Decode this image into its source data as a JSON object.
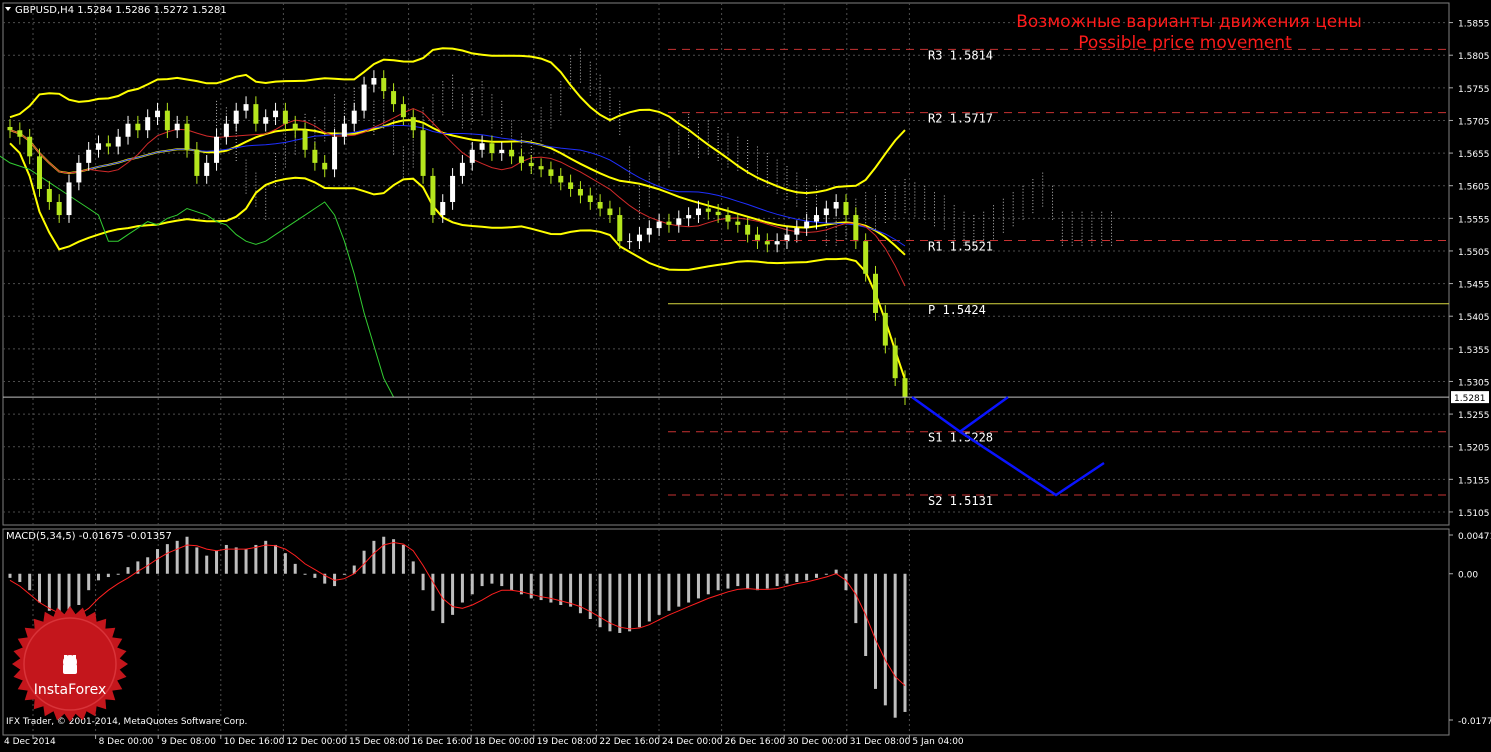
{
  "header": {
    "symbol_info": "GBPUSD,H4  1.5284 1.5286 1.5272 1.5281",
    "macd_info": "MACD(5,34,5) -0.01675 -0.01357",
    "copyright": "IFX Trader, © 2001-2014, MetaQuotes Software Corp.",
    "watermark_ru": "Возможные варианты движения цены",
    "watermark_en": "Possible price movement",
    "logo_text": "InstaForex"
  },
  "colors": {
    "background": "#000000",
    "grid": "#4d4d4d",
    "bull_candle": "#ffffff",
    "bear_candle": "#b5e61d",
    "bollinger": "#ffff00",
    "envelope": "#ffff00",
    "ma_blue": "#1f2fff",
    "ma_red": "#d22a2a",
    "chikou": "#32cd32",
    "kumo": "#b9b9b9",
    "levels_dashed": "#c83232",
    "pivot": "#d8d840",
    "forecast": "#0a14ff",
    "macd_hist": "#bfbfbf",
    "macd_signal": "#ff2020",
    "watermark_text": "#ff1a1a",
    "axis_text": "#ffffff",
    "logo": "#c4161c"
  },
  "chart_data": [
    {
      "type": "candlestick",
      "title": "GBPUSD,H4",
      "ylim": [
        1.5085,
        1.5885
      ],
      "y_ticks": [
        "1.5855",
        "1.5805",
        "1.5755",
        "1.5705",
        "1.5655",
        "1.5605",
        "1.5555",
        "1.5505",
        "1.5455",
        "1.5405",
        "1.5355",
        "1.5305",
        "1.5255",
        "1.5205",
        "1.5155",
        "1.5105"
      ],
      "x_ticks": [
        "4 Dec 2014",
        "8 Dec 00:00",
        "9 Dec 08:00",
        "10 Dec 16:00",
        "12 Dec 00:00",
        "15 Dec 08:00",
        "16 Dec 16:00",
        "18 Dec 00:00",
        "19 Dec 08:00",
        "22 Dec 16:00",
        "24 Dec 00:00",
        "26 Dec 16:00",
        "30 Dec 00:00",
        "31 Dec 08:00",
        "5 Jan 04:00"
      ],
      "current_price": "1.5281",
      "levels": [
        {
          "label": "R3",
          "value": "1.5814",
          "style": "dashed"
        },
        {
          "label": "R2",
          "value": "1.5717",
          "style": "dashed"
        },
        {
          "label": "R1",
          "value": "1.5521",
          "style": "dashed"
        },
        {
          "label": "P",
          "value": "1.5424",
          "style": "solid"
        },
        {
          "label": "S1",
          "value": "1.5228",
          "style": "dashed"
        },
        {
          "label": "S2",
          "value": "1.5131",
          "style": "dashed"
        }
      ],
      "close_series": [
        1.569,
        1.568,
        1.565,
        1.56,
        1.558,
        1.556,
        1.561,
        1.564,
        1.566,
        1.567,
        1.5665,
        1.568,
        1.57,
        1.569,
        1.571,
        1.572,
        1.569,
        1.57,
        1.566,
        1.562,
        1.564,
        1.568,
        1.57,
        1.572,
        1.573,
        1.57,
        1.571,
        1.572,
        1.57,
        1.569,
        1.566,
        1.564,
        1.563,
        1.568,
        1.57,
        1.572,
        1.576,
        1.577,
        1.575,
        1.573,
        1.571,
        1.569,
        1.562,
        1.556,
        1.558,
        1.562,
        1.564,
        1.566,
        1.567,
        1.5655,
        1.566,
        1.565,
        1.564,
        1.5635,
        1.563,
        1.562,
        1.561,
        1.56,
        1.559,
        1.558,
        1.557,
        1.556,
        1.552,
        1.552,
        1.553,
        1.554,
        1.555,
        1.5545,
        1.5555,
        1.556,
        1.557,
        1.5565,
        1.556,
        1.555,
        1.5545,
        1.553,
        1.552,
        1.5515,
        1.552,
        1.553,
        1.554,
        1.555,
        1.556,
        1.557,
        1.558,
        1.556,
        1.552,
        1.547,
        1.541,
        1.536,
        1.531,
        1.5281
      ],
      "forecast_paths": [
        [
          {
            "x": 0,
            "y": 1.5281
          },
          {
            "x": 1,
            "y": 1.5228
          },
          {
            "x": 2,
            "y": 1.5281
          }
        ],
        [
          {
            "x": 1,
            "y": 1.5228
          },
          {
            "x": 3,
            "y": 1.5131
          },
          {
            "x": 4,
            "y": 1.518
          }
        ]
      ]
    },
    {
      "type": "bar",
      "title": "MACD(5,34,5)",
      "ylim": [
        -0.01778,
        0.00471
      ],
      "y_ticks": [
        "0.00471",
        "0.00",
        "-0.01778"
      ],
      "values": [
        -0.0005,
        -0.001,
        -0.002,
        -0.0035,
        -0.0045,
        -0.0055,
        -0.005,
        -0.0038,
        -0.002,
        -0.0008,
        -0.0004,
        0.0,
        0.0008,
        0.0015,
        0.002,
        0.003,
        0.0036,
        0.004,
        0.0045,
        0.0032,
        0.0022,
        0.0028,
        0.0035,
        0.0032,
        0.003,
        0.0035,
        0.004,
        0.0035,
        0.0025,
        0.0012,
        0.0,
        -0.0005,
        -0.0012,
        -0.0015,
        0.0,
        0.001,
        0.0028,
        0.004,
        0.0045,
        0.0042,
        0.0035,
        0.0015,
        -0.002,
        -0.0045,
        -0.006,
        -0.005,
        -0.0035,
        -0.0025,
        -0.0015,
        -0.0012,
        -0.0015,
        -0.002,
        -0.0025,
        -0.003,
        -0.0032,
        -0.0035,
        -0.0038,
        -0.004,
        -0.0048,
        -0.0055,
        -0.0065,
        -0.007,
        -0.0072,
        -0.007,
        -0.0065,
        -0.0058,
        -0.005,
        -0.0045,
        -0.004,
        -0.0035,
        -0.003,
        -0.0025,
        -0.002,
        -0.0018,
        -0.0015,
        -0.0018,
        -0.002,
        -0.0018,
        -0.0015,
        -0.0012,
        -0.001,
        -0.0008,
        -0.0005,
        0.0,
        0.0005,
        -0.002,
        -0.006,
        -0.01,
        -0.014,
        -0.016,
        -0.0175,
        -0.0168
      ],
      "signal": [
        -0.0008,
        -0.0015,
        -0.0025,
        -0.0035,
        -0.0042,
        -0.0048,
        -0.0052,
        -0.005,
        -0.0042,
        -0.003,
        -0.002,
        -0.0012,
        -0.0005,
        0.0003,
        0.001,
        0.0018,
        0.0025,
        0.003,
        0.0035,
        0.0034,
        0.003,
        0.0028,
        0.003,
        0.003,
        0.003,
        0.0032,
        0.0035,
        0.0034,
        0.003,
        0.0022,
        0.0012,
        0.0005,
        -0.0002,
        -0.0008,
        -0.0006,
        0.0,
        0.0012,
        0.0025,
        0.0035,
        0.0038,
        0.0036,
        0.0028,
        0.001,
        -0.001,
        -0.003,
        -0.004,
        -0.0042,
        -0.0038,
        -0.0032,
        -0.0025,
        -0.002,
        -0.002,
        -0.0022,
        -0.0025,
        -0.0028,
        -0.003,
        -0.0033,
        -0.0036,
        -0.004,
        -0.0046,
        -0.0053,
        -0.006,
        -0.0065,
        -0.0067,
        -0.0066,
        -0.0062,
        -0.0056,
        -0.005,
        -0.0045,
        -0.004,
        -0.0035,
        -0.003,
        -0.0026,
        -0.0022,
        -0.0019,
        -0.0018,
        -0.0019,
        -0.0019,
        -0.0018,
        -0.0015,
        -0.0012,
        -0.001,
        -0.0007,
        -0.0004,
        0.0,
        -0.0008,
        -0.0025,
        -0.005,
        -0.008,
        -0.0105,
        -0.0125,
        -0.0136
      ]
    }
  ]
}
